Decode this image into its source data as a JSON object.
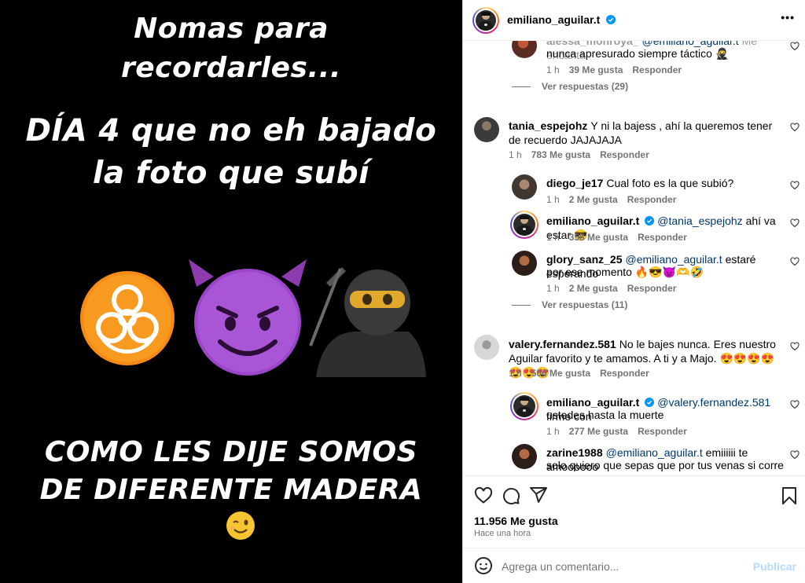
{
  "story": {
    "line1": "Nomas para",
    "line2": "recordarles...",
    "line3": "DÍA 4 que no eh bajado",
    "line4": "la foto que subí",
    "line5": "COMO LES DIJE SOMOS",
    "line6": "DE DIFERENTE MADERA",
    "emojis": [
      "biohazard-emoji",
      "smiling-devil-emoji",
      "ninja-emoji",
      "winking-face-emoji"
    ]
  },
  "header": {
    "username": "emiliano_aguilar.t",
    "more_label": "•••"
  },
  "comments": {
    "c0": {
      "username": "alessa_monroya_",
      "mention": "@emiliano_aguilar.t",
      "text_prefix": "Me encanta",
      "text": "nunca apresurado siempre táctico 🥷",
      "time": "1 h",
      "likes": "39 Me gusta",
      "reply": "Responder"
    },
    "view0": "Ver respuestas (29)",
    "c1": {
      "username": "tania_espejohz",
      "text": "Y ni la bajess , ahí la queremos tener de recuerdo JAJAJAJA",
      "time": "1 h",
      "likes": "783 Me gusta",
      "reply": "Responder"
    },
    "r1": {
      "username": "diego_je17",
      "text": "Cual foto es la que subió?",
      "time": "1 h",
      "likes": "2 Me gusta",
      "reply": "Responder"
    },
    "r2": {
      "username": "emiliano_aguilar.t",
      "mention": "@tania_espejohz",
      "text": "ahí va estar 😎",
      "time": "1 h",
      "likes": "358 Me gusta",
      "reply": "Responder"
    },
    "r3": {
      "username": "glory_sanz_25",
      "mention": "@emiliano_aguilar.t",
      "text_a": "estaré esperando",
      "text_b": "por ese momento 🔥😎😈🫶🤣",
      "time": "1 h",
      "likes": "2 Me gusta",
      "reply": "Responder"
    },
    "view1": "Ver respuestas (11)",
    "c2": {
      "username": "valery.fernandez.581",
      "text": "No le bajes nunca. Eres nuestro Aguilar favorito y te amamos. A ti y a Majo. 😍😍😍😍😍😍😍",
      "time": "1 h",
      "likes": "506 Me gusta",
      "reply": "Responder"
    },
    "r4": {
      "username": "emiliano_aguilar.t",
      "mention": "@valery.fernandez.581",
      "text_a": "firme con",
      "text_b": "ustedes hasta la muerte",
      "time": "1 h",
      "likes": "277 Me gusta",
      "reply": "Responder"
    },
    "r5": {
      "username": "zarine1988",
      "mention": "@emiliano_aguilar.t",
      "text_a": "emiiiiii te amoooooo",
      "text_b": "solo quiero que sepas que por tus venas si corre"
    }
  },
  "actions": {
    "likes": "11.956 Me gusta",
    "time": "Hace una hora"
  },
  "composer": {
    "placeholder": "Agrega un comentario...",
    "publish": "Publicar"
  },
  "colors": {
    "verified": "#0095f6",
    "mention": "#00376b",
    "secondary": "#737373",
    "publish_disabled": "#b3dbff"
  }
}
